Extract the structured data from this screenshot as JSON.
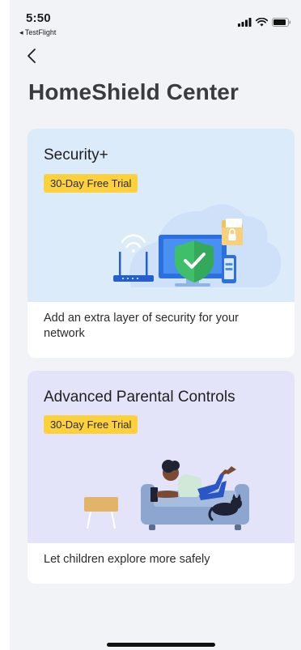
{
  "status_bar": {
    "time": "5:50",
    "back_app": "◂ TestFlight",
    "icons": [
      "cellular-signal-icon",
      "wifi-icon",
      "battery-icon"
    ]
  },
  "nav": {
    "back_icon": "chevron-left-icon"
  },
  "page": {
    "title": "HomeShield Center"
  },
  "cards": [
    {
      "title": "Security+",
      "badge": "30-Day Free Trial",
      "description": "Add an extra layer of security for your network",
      "illustration": "security-illustration"
    },
    {
      "title": "Advanced Parental Controls",
      "badge": "30-Day Free Trial",
      "description": "Let children explore more safely",
      "illustration": "parental-controls-illustration"
    }
  ],
  "colors": {
    "background": "#f2f3f7",
    "card_1_hero": "#dcebfa",
    "card_2_hero": "#e3e4fa",
    "badge": "#fdd13b",
    "shield_green": "#3fbf6a",
    "device_blue": "#2b6fe0"
  }
}
